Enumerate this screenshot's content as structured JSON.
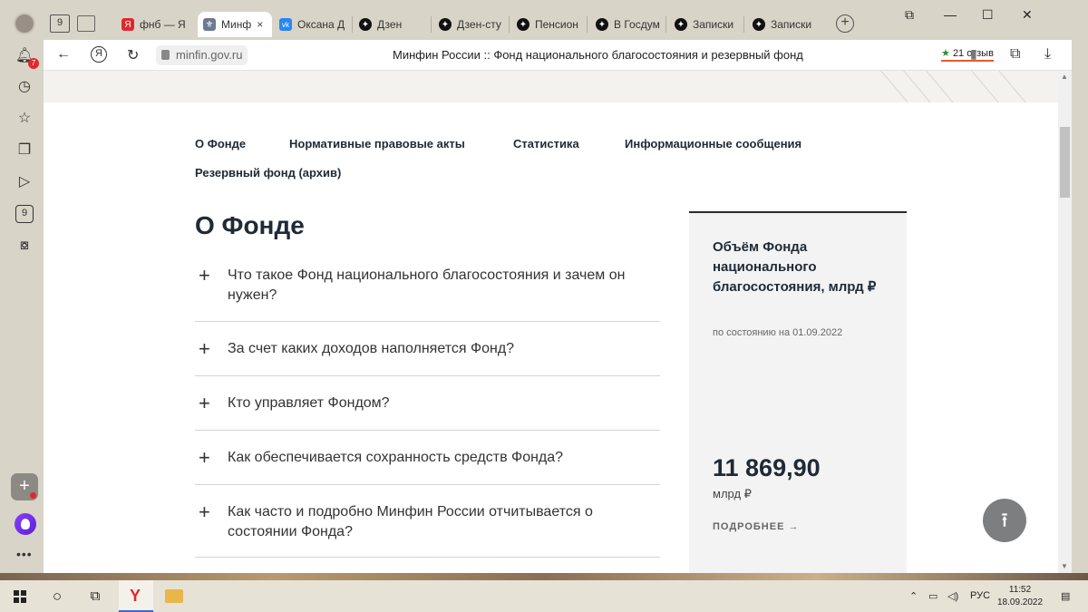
{
  "browser": {
    "home_tab_badge": "9",
    "tabs": [
      {
        "label": "фнб — Я",
        "favicon": "yandex-icon",
        "active": false
      },
      {
        "label": "Минф",
        "favicon": "minfin-emblem-icon",
        "active": true
      },
      {
        "label": "Оксана Д",
        "favicon": "vk-icon",
        "active": false
      },
      {
        "label": "Дзен",
        "favicon": "dzen-icon",
        "active": false
      },
      {
        "label": "Дзен-сту",
        "favicon": "dzen-icon",
        "active": false
      },
      {
        "label": "Пенсион",
        "favicon": "dzen-icon",
        "active": false
      },
      {
        "label": "В Госдум",
        "favicon": "dzen-icon",
        "active": false
      },
      {
        "label": "Записки",
        "favicon": "dzen-icon",
        "active": false
      },
      {
        "label": "Записки",
        "favicon": "dzen-icon",
        "active": false
      }
    ],
    "active_tab_close": "×",
    "url": "minfin.gov.ru",
    "page_title": "Минфин России :: Фонд национального благосостояния и резервный фонд",
    "reviews": "21 отзыв",
    "reviews_star": "★",
    "sidebar_badges": {
      "notifications": "7",
      "counter": "9"
    }
  },
  "site": {
    "nav": [
      "О Фонде",
      "Нормативные правовые акты",
      "Статистика",
      "Информационные сообщения",
      "Резервный фонд (архив)"
    ],
    "heading": "О Фонде",
    "faq": [
      "Что такое Фонд национального благосостояния и зачем он нужен?",
      "За счет каких доходов наполняется Фонд?",
      "Кто управляет Фондом?",
      "Как обеспечивается сохранность средств Фонда?",
      "Как часто и подробно Минфин России отчитывается о состоянии Фонда?"
    ],
    "faq_expand_symbol": "+",
    "card": {
      "title": "Объём Фонда национального благосостояния, млрд ₽",
      "date": "по состоянию на 01.09.2022",
      "value": "11 869,90",
      "unit": "млрд ₽",
      "more": "ПОДРОБНЕЕ →"
    },
    "to_top_symbol": "⭱"
  },
  "taskbar": {
    "language": "РУС",
    "time": "11:52",
    "date": "18.09.2022"
  },
  "colors": {
    "chrome": "#d9d4c8",
    "heading": "#1f2a35",
    "card_bg": "#f3f3f3",
    "yandex_red": "#e0282e",
    "vk_blue": "#2787f5"
  }
}
